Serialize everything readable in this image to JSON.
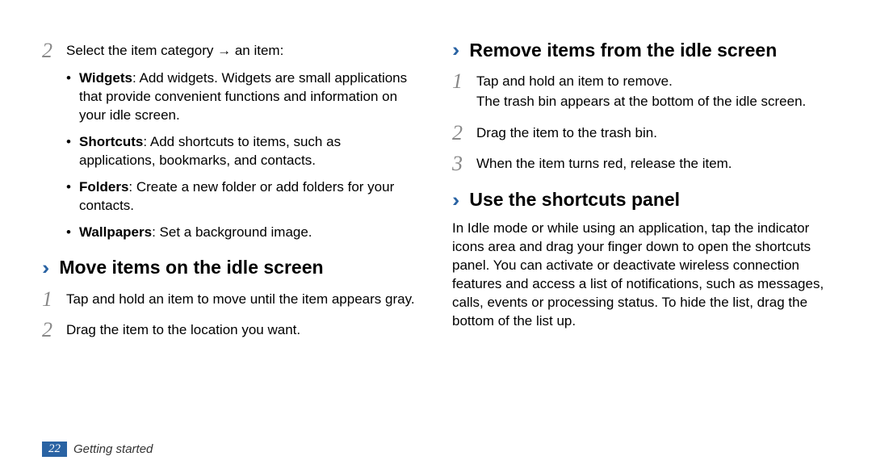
{
  "left": {
    "step2": {
      "num": "2",
      "lead_before_arrow": "Select the item category ",
      "arrow": "→",
      "lead_after_arrow": " an item:"
    },
    "bullets": [
      {
        "term": "Widgets",
        "desc": ": Add widgets. Widgets are small applications that provide convenient functions and information on your idle screen."
      },
      {
        "term": "Shortcuts",
        "desc": ": Add shortcuts to items, such as applications, bookmarks, and contacts."
      },
      {
        "term": "Folders",
        "desc": ": Create a new folder or add folders for your contacts."
      },
      {
        "term": "Wallpapers",
        "desc": ": Set a background image."
      }
    ],
    "move_heading": "Move items on the idle screen",
    "move_steps": [
      {
        "num": "1",
        "text": "Tap and hold an item to move until the item appears gray."
      },
      {
        "num": "2",
        "text": "Drag the item to the location you want."
      }
    ]
  },
  "right": {
    "remove_heading": "Remove items from the idle screen",
    "remove_steps": [
      {
        "num": "1",
        "text": "Tap and hold an item to remove.",
        "extra": "The trash bin appears at the bottom of the idle screen."
      },
      {
        "num": "2",
        "text": "Drag the item to the trash bin."
      },
      {
        "num": "3",
        "text": "When the item turns red, release the item."
      }
    ],
    "shortcuts_heading": "Use the shortcuts panel",
    "shortcuts_para": "In Idle mode or while using an application, tap the indicator icons area and drag your finger down to open the shortcuts panel. You can activate or deactivate wireless connection features and access a list of notifications, such as messages, calls, events or processing status. To hide the list, drag the bottom of the list up."
  },
  "footer": {
    "page_num": "22",
    "section": "Getting started"
  }
}
